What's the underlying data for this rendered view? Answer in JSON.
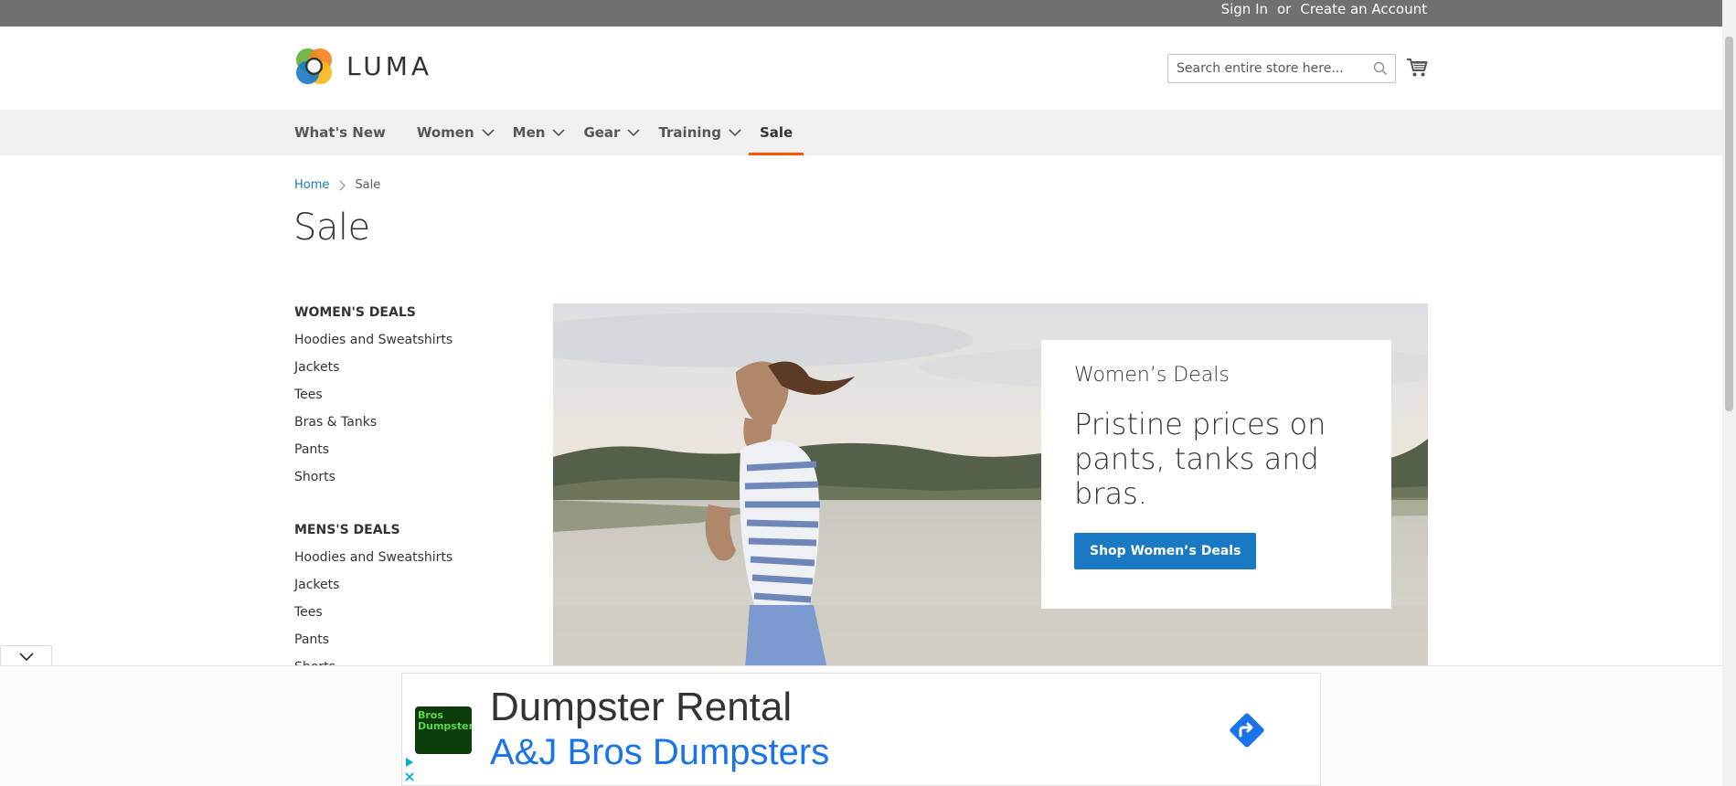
{
  "topbar": {
    "sign_in": "Sign In",
    "or": "or",
    "create_account": "Create an Account"
  },
  "header": {
    "logo_text": "LUMA",
    "search_placeholder": "Search entire store here...",
    "search_icon": "magnifier-icon",
    "cart_icon": "shopping-cart-icon"
  },
  "nav": {
    "items": [
      {
        "label": "What's New",
        "dropdown": false
      },
      {
        "label": "Women",
        "dropdown": true
      },
      {
        "label": "Men",
        "dropdown": true
      },
      {
        "label": "Gear",
        "dropdown": true
      },
      {
        "label": "Training",
        "dropdown": true
      },
      {
        "label": "Sale",
        "dropdown": false,
        "active": true
      }
    ]
  },
  "breadcrumb": {
    "home": "Home",
    "current": "Sale"
  },
  "page_title": "Sale",
  "sidebar": {
    "womens_heading": "WOMEN'S DEALS",
    "womens_items": [
      "Hoodies and Sweatshirts",
      "Jackets",
      "Tees",
      "Bras & Tanks",
      "Pants",
      "Shorts"
    ],
    "mens_heading": "MENS'S DEALS",
    "mens_items": [
      "Hoodies and Sweatshirts",
      "Jackets",
      "Tees",
      "Pants",
      "Shorts"
    ]
  },
  "hero": {
    "kicker": "Women’s Deals",
    "headline": "Pristine prices on pants, tanks and bras.",
    "cta": "Shop Women’s Deals"
  },
  "ad": {
    "logo_text": "Bros Dumpsters",
    "title": "Dumpster Rental",
    "subtitle": "A&J Bros Dumpsters",
    "icons": [
      "directions-icon",
      "adchoices-play-icon",
      "close-icon"
    ]
  },
  "colors": {
    "topbar": "#6e716e",
    "nav_bg": "#f0f0f0",
    "accent": "#ff5501",
    "link": "#1979c3",
    "ad_link": "#1a73e8"
  }
}
